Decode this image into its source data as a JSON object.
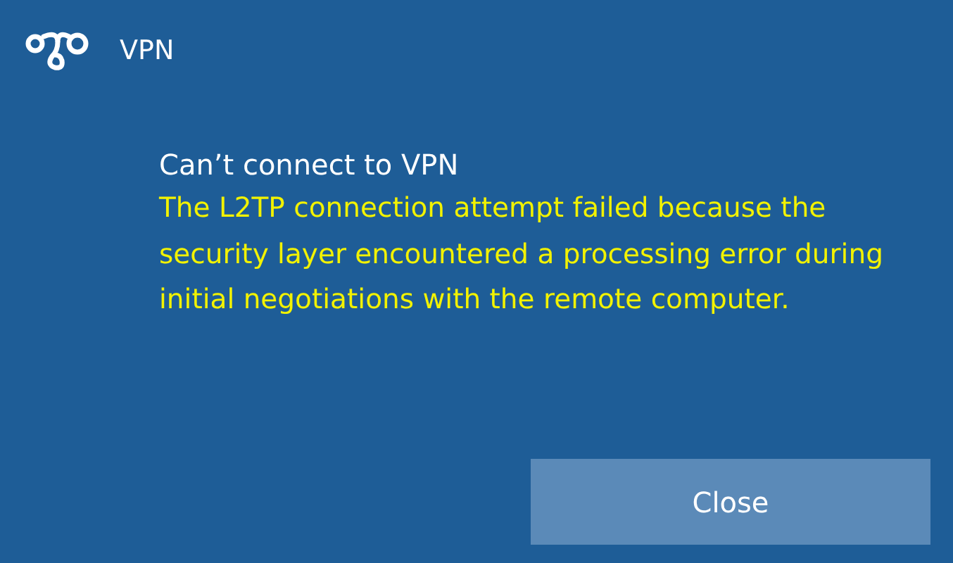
{
  "app": {
    "name": "VPN"
  },
  "message": {
    "title": "Can’t connect to VPN",
    "detail": "The L2TP connection attempt failed because the security layer encountered a processing error during initial negotiations with the remote computer."
  },
  "buttons": [
    {
      "label": "Close"
    }
  ]
}
